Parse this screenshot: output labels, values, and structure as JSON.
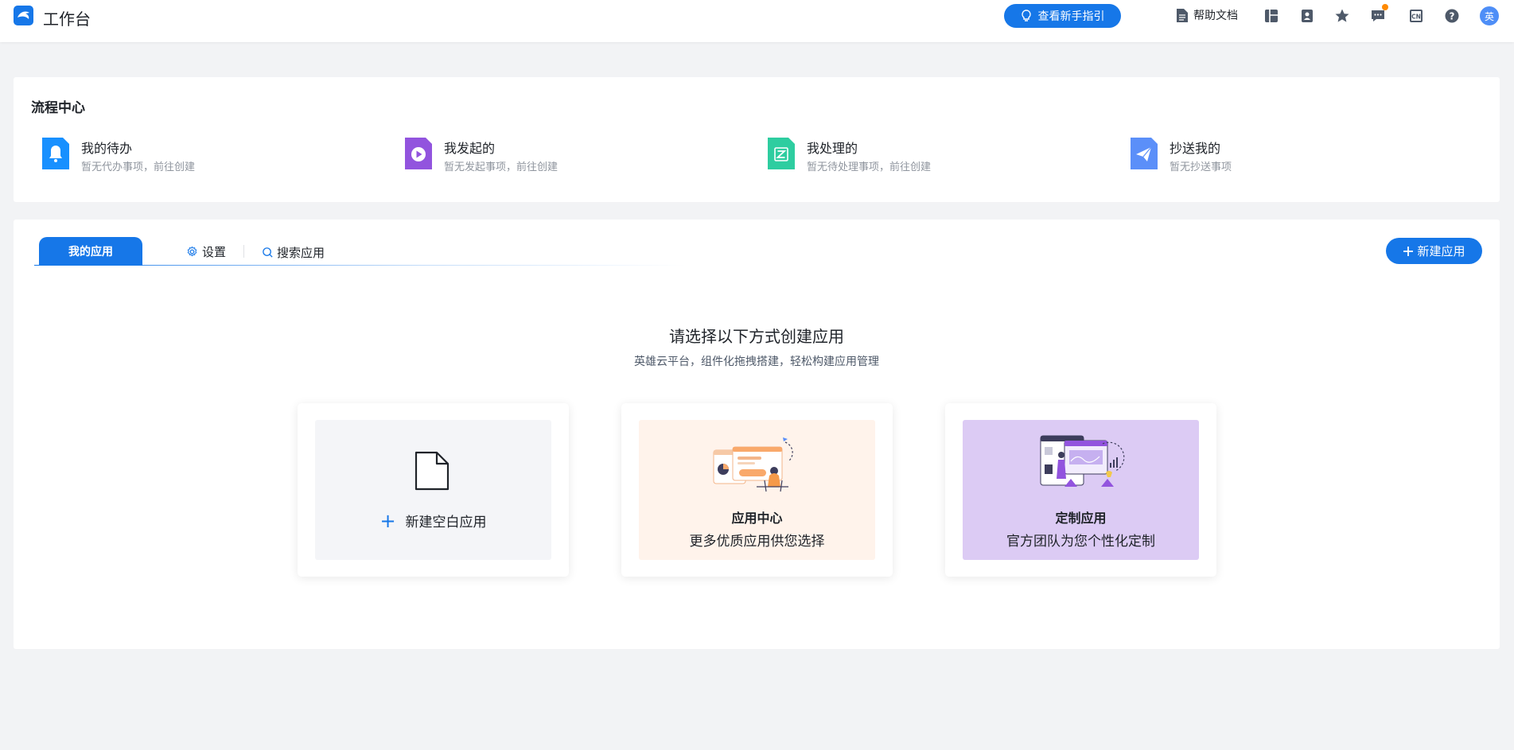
{
  "header": {
    "title": "工作台",
    "guide_button": "查看新手指引",
    "help_doc": "帮助文档",
    "avatar_text": "英",
    "icons": [
      "layout-icon",
      "contacts-icon",
      "star-icon",
      "message-icon",
      "language-cn-icon",
      "help-icon"
    ],
    "accent_color": "#1677e8",
    "notification_dot_color": "#ff8a00"
  },
  "process_center": {
    "title": "流程中心",
    "items": [
      {
        "label": "我的待办",
        "sub": "暂无代办事项，前往创建",
        "icon": "bell-icon",
        "color": "#1890ff"
      },
      {
        "label": "我发起的",
        "sub": "暂无发起事项，前往创建",
        "icon": "play-icon",
        "color": "#9254de"
      },
      {
        "label": "我处理的",
        "sub": "暂无待处理事项，前往创建",
        "icon": "process-z-icon",
        "color": "#2ecda0"
      },
      {
        "label": "抄送我的",
        "sub": "暂无抄送事项",
        "icon": "send-icon",
        "color": "#5b8ff9"
      }
    ]
  },
  "apps": {
    "tabs": {
      "active": "我的应用",
      "settings": "设置",
      "search": "搜索应用"
    },
    "new_app_button": "新建应用",
    "heading": "请选择以下方式创建应用",
    "subheading": "英雄云平台，组件化拖拽搭建，轻松构建应用管理",
    "options": [
      {
        "label": "新建空白应用",
        "icon": "blank-document-icon"
      },
      {
        "title": "应用中心",
        "desc": "更多优质应用供您选择",
        "icon": "app-center-illustration",
        "bg": "#fff3eb"
      },
      {
        "title": "定制应用",
        "desc": "官方团队为您个性化定制",
        "icon": "custom-app-illustration",
        "bg": "#dccbf4"
      }
    ]
  }
}
